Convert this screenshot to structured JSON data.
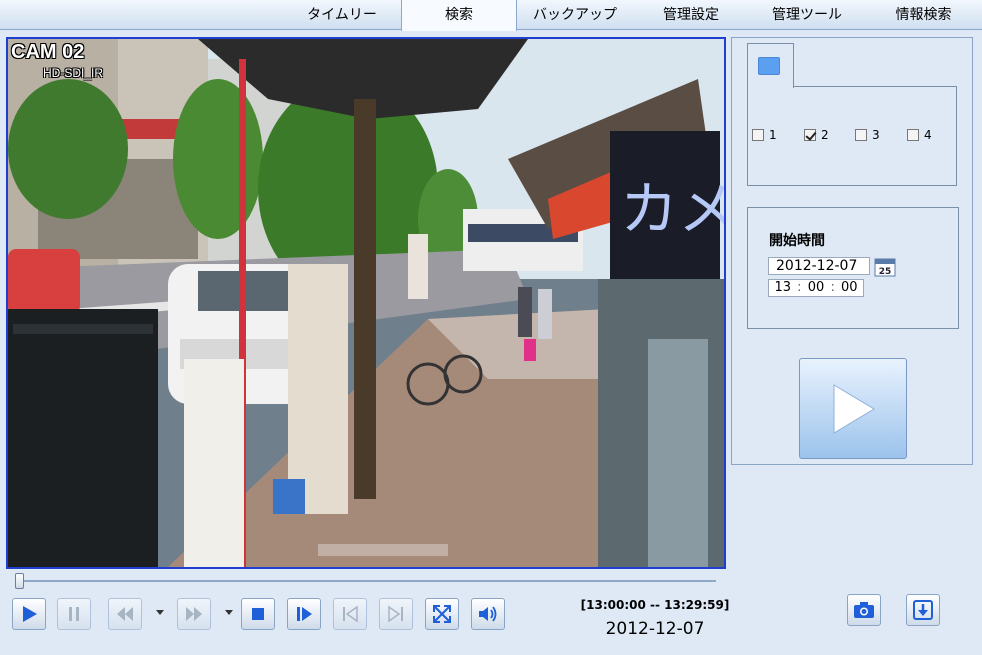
{
  "tabs": [
    {
      "label": "タイムリー",
      "active": false
    },
    {
      "label": "検索",
      "active": true
    },
    {
      "label": "バックアップ",
      "active": false
    },
    {
      "label": "管理設定",
      "active": false
    },
    {
      "label": "管理ツール",
      "active": false
    },
    {
      "label": "情報検索",
      "active": false
    }
  ],
  "video": {
    "camera_name": "CAM 02",
    "camera_sub": "HD-SDI_IR"
  },
  "playback": {
    "position": 0,
    "time_range": "[13:00:00 -- 13:29:59]",
    "date": "2012-12-07",
    "buttons": [
      "play-icon",
      "pause-icon",
      "rewind-icon",
      "fast-forward-icon",
      "stop-icon",
      "step-forward-icon",
      "skip-start-icon",
      "skip-end-icon",
      "fullscreen-icon",
      "volume-icon"
    ]
  },
  "channels": {
    "items": [
      {
        "label": "1",
        "checked": false
      },
      {
        "label": "2",
        "checked": true
      },
      {
        "label": "3",
        "checked": false
      },
      {
        "label": "4",
        "checked": false
      }
    ]
  },
  "start_time": {
    "label": "開始時間",
    "date": "2012-12-07",
    "calendar_day": "25",
    "hour": "13",
    "minute": "00",
    "second": "00"
  },
  "colors": {
    "accent": "#1f3fd0",
    "icon_blue": "#1f5fd8",
    "panel_bg": "#dfe9f5"
  }
}
